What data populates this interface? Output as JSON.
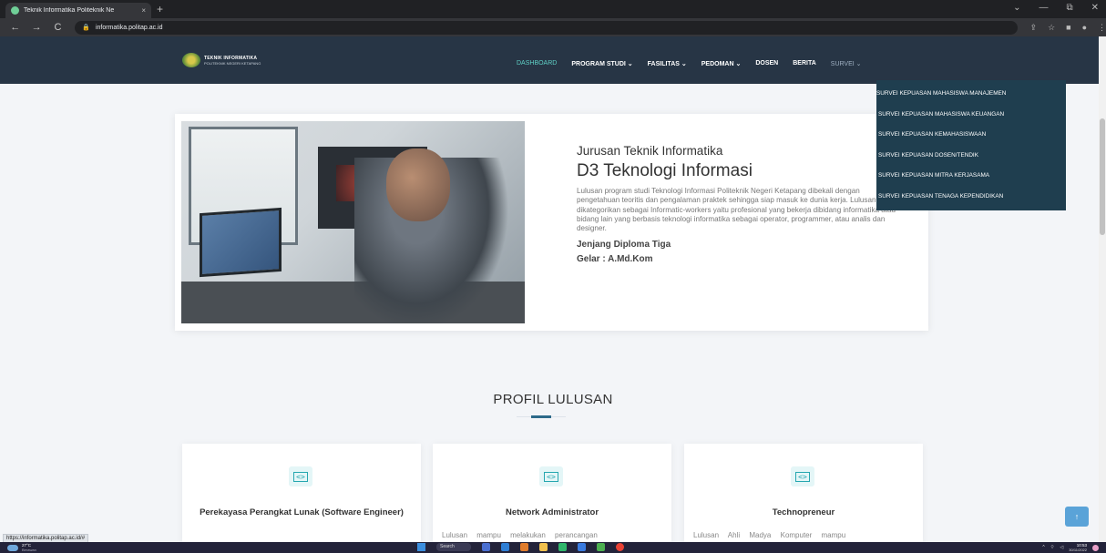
{
  "browser": {
    "tab_title": "Teknik Informatika Politeknik Ne",
    "tab_close": "×",
    "new_tab": "+",
    "url": "informatika.politap.ac.id",
    "window_controls": [
      "⌄",
      "—",
      "⧉",
      "✕"
    ]
  },
  "site": {
    "logo_line1": "TEKNIK INFORMATIKA",
    "logo_line2": "POLITEKNIK NEGERI KETAPANG",
    "menu": [
      "DASHBOARD",
      "PROGRAM STUDI ⌄",
      "FASILITAS ⌄",
      "PEDOMAN ⌄",
      "DOSEN",
      "BERITA",
      "SURVEI ⌄"
    ],
    "survey_dropdown": [
      "SURVEI KEPUASAN MAHASISWA MANAJEMEN",
      "SURVEI KEPUASAN MAHASISWA KEUANGAN",
      "SURVEI KEPUASAN KEMAHASISWAAN",
      "SURVEI KEPUASAN DOSEN/TENDIK",
      "SURVEI KEPUASAN MITRA KERJASAMA",
      "SURVEI KEPUASAN TENAGA KEPENDIDIKAN"
    ]
  },
  "hero": {
    "subhead": "Jurusan Teknik Informatika",
    "title": "D3 Teknologi Informasi",
    "description": "Lulusan program studi Teknologi Informasi Politeknik Negeri Ketapang dibekali dengan pengetahuan teoritis dan pengalaman praktek sehingga siap masuk ke dunia kerja. Lulusan dikategorikan sebagai Informatic-workers yaitu profesional yang bekerja dibidang informatika atau bidang lain yang berbasis teknologi informatika sebagai operator, programmer, atau analis dan designer.",
    "jenjang": "Jenjang Diploma Tiga",
    "gelar": "Gelar : A.Md.Kom"
  },
  "profil": {
    "title": "PROFIL LULUSAN",
    "cards": [
      {
        "title": "Perekayasa Perangkat Lunak (Software Engineer)",
        "desc": "",
        "icon": "code-icon"
      },
      {
        "title": "Network Administrator",
        "desc": "Lulusan mampu melakukan perancangan",
        "icon": "code-icon"
      },
      {
        "title": "Technopreneur",
        "desc": "Lulusan Ahli Madya Komputer mampu",
        "icon": "code-icon"
      }
    ]
  },
  "status_url": "https://informatika.politap.ac.id/#",
  "taskbar": {
    "weather_temp": "27°C",
    "weather_desc": "Berawan",
    "search": "Search",
    "time": "10:53",
    "date": "30/11/2022"
  }
}
